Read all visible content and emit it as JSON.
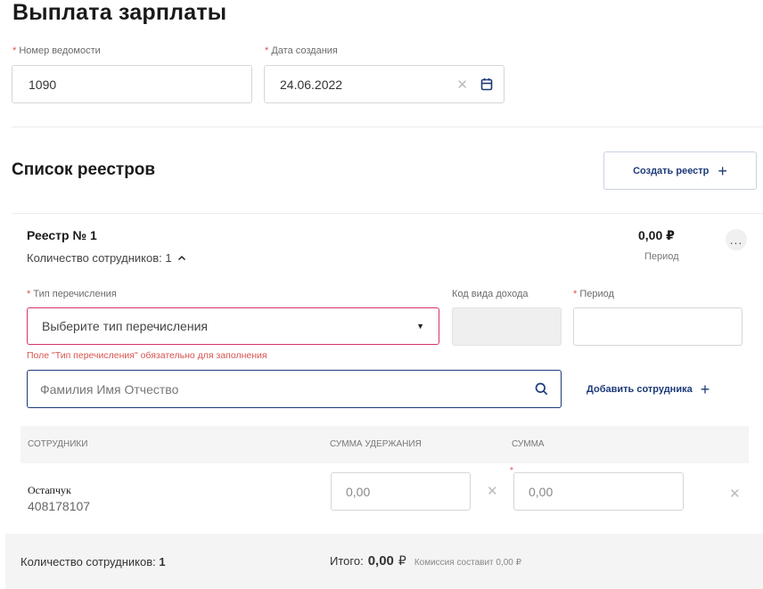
{
  "page": {
    "title": "Выплата зарплаты"
  },
  "form": {
    "number_label": "Номер ведомости",
    "number_value": "1090",
    "date_label": "Дата создания",
    "date_value": "24.06.2022",
    "required_mark": "*"
  },
  "registries": {
    "title": "Список реестров",
    "create_button": "Создать реестр"
  },
  "registry": {
    "name": "Реестр № 1",
    "amount": "0,00 ₽",
    "period_caption": "Период",
    "employees_count_label": "Количество сотрудников: 1",
    "more_label": "...",
    "transfer_type_label": "Тип перечисления",
    "transfer_type_placeholder": "Выберите тип перечисления",
    "income_code_label": "Код вида дохода",
    "period_label": "Период",
    "error_text": "Поле \"Тип перечисления\" обязательно для заполнения",
    "search_placeholder": "Фамилия Имя Отчество",
    "add_employee": "Добавить сотрудника"
  },
  "table": {
    "headers": [
      "СОТРУДНИКИ",
      "СУММА УДЕРЖАНИЯ",
      "СУММА"
    ],
    "rows": [
      {
        "name": "Остапчук",
        "account": "408178107",
        "deduction": "0,00",
        "sum": "0,00"
      }
    ]
  },
  "footer": {
    "count_label": "Количество сотрудников:",
    "count_value": "1",
    "total_label": "Итого:",
    "total_value": "0,00",
    "currency": "₽",
    "commission": "Комиссия составит 0,00 ₽"
  }
}
